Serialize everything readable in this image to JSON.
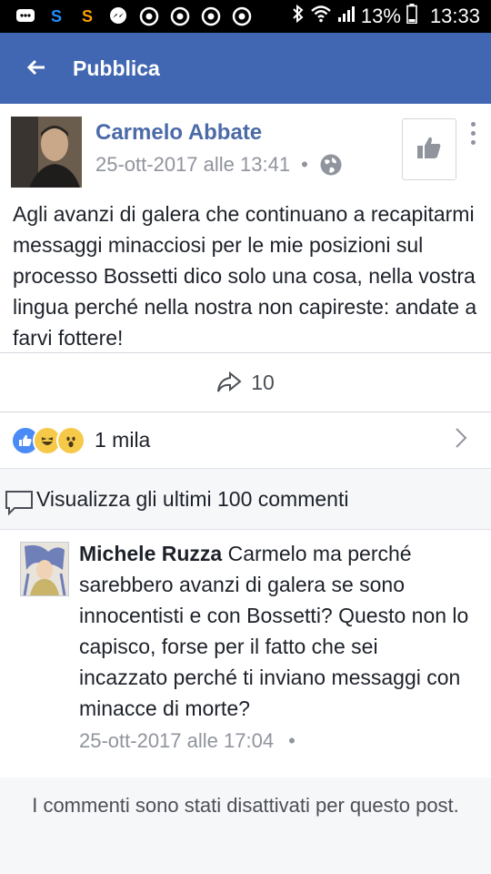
{
  "status_bar": {
    "icons": [
      "chat-icon",
      "skype-icon",
      "swarm-icon",
      "messenger-icon",
      "chrome-icon",
      "chrome-icon",
      "chrome-icon",
      "chrome-icon"
    ],
    "battery": "13%",
    "time": "13:33"
  },
  "app_bar": {
    "title": "Pubblica"
  },
  "post": {
    "author": "Carmelo Abbate",
    "timestamp": "25-ott-2017 alle 13:41",
    "separator": "•",
    "text": "Agli avanzi di galera che continuano a recapitarmi messaggi minacciosi per le mie posizioni sul processo Bossetti dico solo una cosa, nella vostra lingua perché nella nostra non capireste: andate a farvi fottere!",
    "shares": "10",
    "reactions_count": "1 mila",
    "reaction_colors": {
      "like": "#4b8bf5",
      "haha": "#f7c949",
      "wow": "#f7c949"
    }
  },
  "comments_link": {
    "label": "Visualizza gli ultimi 100 commenti"
  },
  "comment": {
    "name": "Michele Ruzza",
    "text": "Carmelo ma perché sarebbero avanzi di galera se sono innocentisti e con Bossetti? Questo non lo capisco, forse per il fatto che sei incazzato perché ti inviano messaggi con minacce di morte?",
    "timestamp": "25-ott-2017 alle 17:04",
    "separator": "•"
  },
  "footer": {
    "disabled_text": "I commenti sono stati disattivati per questo post."
  },
  "colors": {
    "app_bar": "#4267b2",
    "author_link": "#4b6aa8",
    "meta": "#90949c"
  }
}
